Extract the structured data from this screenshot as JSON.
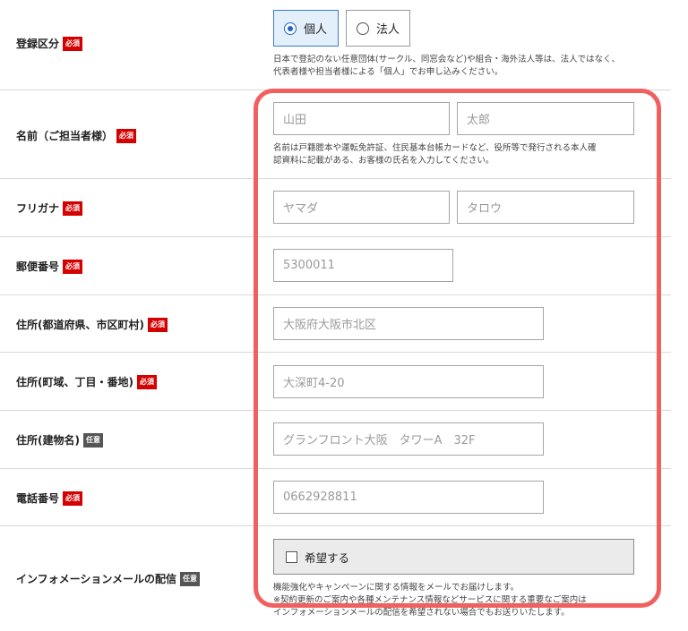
{
  "form": {
    "registration": {
      "label": "登録区分",
      "badge": "必須",
      "options": [
        "個人",
        "法人"
      ],
      "selected": "個人",
      "note_line1": "日本で登記のない任意団体(サークル、同窓会など)や組合・海外法人等は、法人ではなく、",
      "note_line2": "代表者様や担当者様による「個人」でお申し込みください。"
    },
    "name": {
      "label": "名前（ご担当者様）",
      "badge": "必須",
      "last_placeholder": "山田",
      "first_placeholder": "太郎",
      "note_line1": "名前は戸籍謄本や運転免許証、住民基本台帳カードなど、役所等で発行される本人確",
      "note_line2": "認資料に記載がある、お客様の氏名を入力してください。"
    },
    "furigana": {
      "label": "フリガナ",
      "badge": "必須",
      "last_placeholder": "ヤマダ",
      "first_placeholder": "タロウ"
    },
    "postal": {
      "label": "郵便番号",
      "badge": "必須",
      "placeholder": "5300011"
    },
    "address1": {
      "label": "住所(都道府県、市区町村)",
      "badge": "必須",
      "placeholder": "大阪府大阪市北区"
    },
    "address2": {
      "label": "住所(町域、丁目・番地)",
      "badge": "必須",
      "placeholder": "大深町4-20"
    },
    "building": {
      "label": "住所(建物名)",
      "badge": "任意",
      "placeholder": "グランフロント大阪　タワーA　32F"
    },
    "phone": {
      "label": "電話番号",
      "badge": "必須",
      "placeholder": "0662928811"
    },
    "newsletter": {
      "label": "インフォメーションメールの配信",
      "badge": "任意",
      "checkbox_label": "希望する",
      "note_line1": "機能強化やキャンペーンに関する情報をメールでお届けします。",
      "note_line2": "※契約更新のご案内や各種メンテナンス情報などサービスに関する重要なご案内は",
      "note_line3": "インフォメーションメールの配信を希望されない場合でもお送りいたします。"
    }
  },
  "colors": {
    "required_badge": "#d50000",
    "optional_badge": "#555555",
    "highlight_border": "#f0605e",
    "selected_radio_bg": "#e3f0fb"
  }
}
